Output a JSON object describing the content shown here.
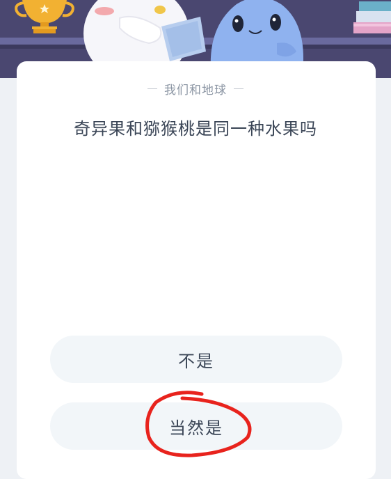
{
  "quiz": {
    "category": "我们和地球",
    "question": "奇异果和猕猴桃是同一种水果吗",
    "options": [
      "不是",
      "当然是"
    ]
  },
  "colors": {
    "header_bg": "#4a4770",
    "card_bg": "#ffffff",
    "option_bg": "#f2f6f9",
    "text": "#3a4556",
    "subtitle": "#8c96a4",
    "annotation": "#e8231d"
  }
}
